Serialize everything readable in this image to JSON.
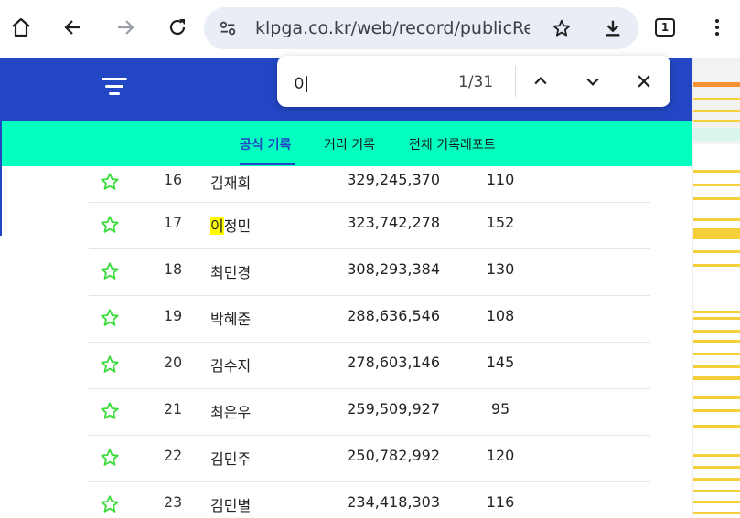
{
  "browser": {
    "url": "klpga.co.kr/web/record/publicRec",
    "tab_count": "1"
  },
  "find": {
    "query": "이",
    "result_count": "1/31"
  },
  "subnav": {
    "tabs": [
      "공식 기록",
      "거리 기록",
      "전체 기록레포트"
    ]
  },
  "colors": {
    "header_blue": "#2347c4",
    "subnav_green": "#03ffc0",
    "star_green": "#3ddc3d",
    "highlight": "#ffff00"
  },
  "rows": [
    {
      "rank": "16",
      "name": "김재희",
      "money": "329,245,370",
      "count": "110"
    },
    {
      "rank": "17",
      "name_hl": "이",
      "name_rest": "정민",
      "money": "323,742,278",
      "count": "152"
    },
    {
      "rank": "18",
      "name": "최민경",
      "money": "308,293,384",
      "count": "130"
    },
    {
      "rank": "19",
      "name": "박혜준",
      "money": "288,636,546",
      "count": "108"
    },
    {
      "rank": "20",
      "name": "김수지",
      "money": "278,603,146",
      "count": "145"
    },
    {
      "rank": "21",
      "name": "최은우",
      "money": "259,509,927",
      "count": "95"
    },
    {
      "rank": "22",
      "name": "김민주",
      "money": "250,782,992",
      "count": "120"
    },
    {
      "rank": "23",
      "name": "김민별",
      "money": "234,418,303",
      "count": "116"
    }
  ]
}
